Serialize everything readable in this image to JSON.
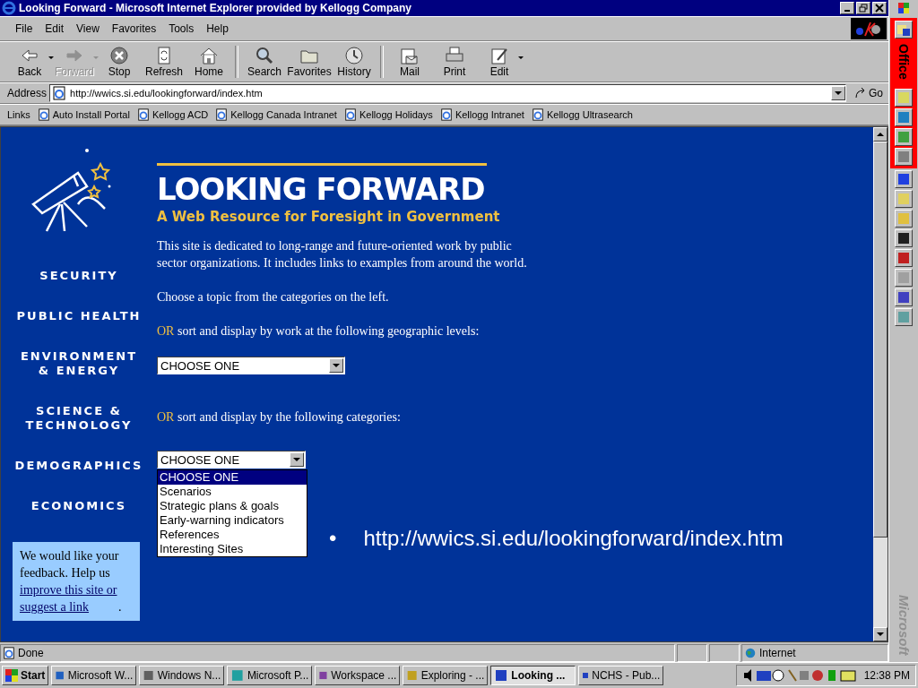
{
  "window": {
    "title": "Looking Forward - Microsoft Internet Explorer provided by Kellogg Company"
  },
  "menu": [
    "File",
    "Edit",
    "View",
    "Favorites",
    "Tools",
    "Help"
  ],
  "toolbar": [
    {
      "kind": "back",
      "label": "Back",
      "disabled": false,
      "dropdown": true
    },
    {
      "kind": "forward",
      "label": "Forward",
      "disabled": true,
      "dropdown": true
    },
    {
      "kind": "stop",
      "label": "Stop",
      "disabled": false,
      "dropdown": false
    },
    {
      "kind": "refresh",
      "label": "Refresh",
      "disabled": false,
      "dropdown": false
    },
    {
      "kind": "home",
      "label": "Home",
      "disabled": false,
      "dropdown": false
    },
    {
      "kind": "search",
      "label": "Search",
      "disabled": false,
      "dropdown": false
    },
    {
      "kind": "favorites",
      "label": "Favorites",
      "disabled": false,
      "dropdown": false
    },
    {
      "kind": "history",
      "label": "History",
      "disabled": false,
      "dropdown": false
    },
    {
      "kind": "mail",
      "label": "Mail",
      "disabled": false,
      "dropdown": false
    },
    {
      "kind": "print",
      "label": "Print",
      "disabled": false,
      "dropdown": false
    },
    {
      "kind": "edit",
      "label": "Edit",
      "disabled": false,
      "dropdown": true
    }
  ],
  "address": {
    "label": "Address",
    "value": "http://wwics.si.edu/lookingforward/index.htm",
    "go": "Go"
  },
  "links": {
    "label": "Links",
    "items": [
      "Auto Install Portal",
      "Kellogg ACD",
      "Kellogg Canada Intranet",
      "Kellogg Holidays",
      "Kellogg Intranet",
      "Kellogg Ultrasearch"
    ]
  },
  "page": {
    "title": "LOOKING FORWARD",
    "subtitle": "A Web Resource for Foresight in Government",
    "nav": [
      {
        "label": "SECURITY"
      },
      {
        "label": "PUBLIC HEALTH"
      },
      {
        "label": "ENVIRONMENT & ENERGY"
      },
      {
        "label": "SCIENCE & TECHNOLOGY"
      },
      {
        "label": "DEMOGRAPHICS"
      },
      {
        "label": "ECONOMICS"
      }
    ],
    "intro": "This site is dedicated to long-range and future-oriented work by public sector organizations. It includes links to examples from around the world.",
    "choose": "Choose a topic from the categories on the left.",
    "geo": {
      "or": "OR",
      "text": "sort and display by work at the following geographic levels:",
      "select": {
        "value": "CHOOSE ONE"
      }
    },
    "categories": {
      "or": "OR",
      "text": "sort and display by the following categories:",
      "select": {
        "value": "CHOOSE ONE",
        "options": [
          {
            "label": "CHOOSE ONE",
            "selected": true
          },
          {
            "label": "Scenarios",
            "selected": false
          },
          {
            "label": "Strategic plans & goals",
            "selected": false
          },
          {
            "label": "Early-warning indicators",
            "selected": false
          },
          {
            "label": "References",
            "selected": false
          },
          {
            "label": "Interesting Sites",
            "selected": false
          }
        ]
      }
    },
    "feedback": {
      "text": "We would like your feedback. Help us",
      "link": "improve this site or suggest a link",
      "end": "."
    },
    "overlay": {
      "bullet": "•",
      "text": "http://wwics.si.edu/lookingforward/index.htm"
    }
  },
  "status_bar": {
    "text": "Done",
    "zone": "Internet"
  },
  "office_bar": {
    "title": "Office",
    "footer": "Microsoft"
  },
  "taskbar": {
    "start": "Start",
    "clock": "12:38 PM",
    "tasks": [
      {
        "label": "Microsoft W...",
        "selected": false
      },
      {
        "label": "Windows N...",
        "selected": false
      },
      {
        "label": "Microsoft P...",
        "selected": false
      },
      {
        "label": "Workspace ...",
        "selected": false
      },
      {
        "label": "Exploring - ...",
        "selected": false
      },
      {
        "label": "Looking ...",
        "selected": true
      },
      {
        "label": "NCHS - Pub...",
        "selected": false
      }
    ]
  }
}
